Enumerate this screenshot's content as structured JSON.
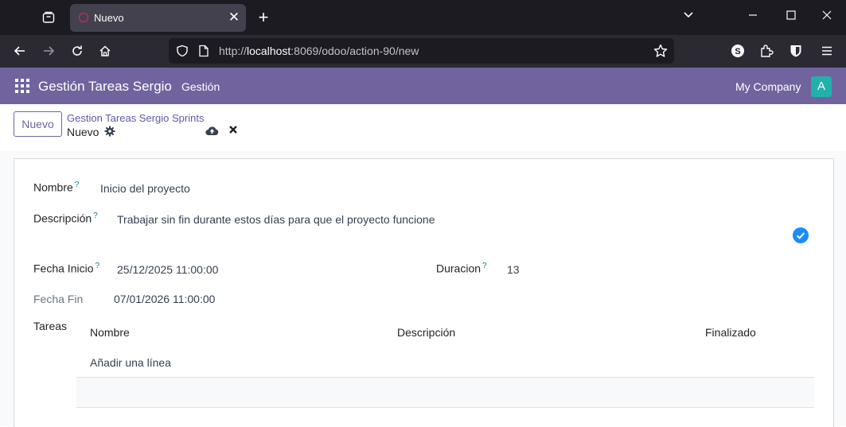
{
  "browser": {
    "tab_title": "Nuevo",
    "url_prefix": "http://",
    "url_host": "localhost",
    "url_rest": ":8069/odoo/action-90/new"
  },
  "app": {
    "name": "Gestión Tareas Sergio",
    "menu": "Gestión",
    "company": "My Company",
    "avatar_letter": "A",
    "accent": "#71639e"
  },
  "control": {
    "new_button": "Nuevo",
    "breadcrumb": "Gestion Tareas Sergio Sprints",
    "record": "Nuevo"
  },
  "form": {
    "nombre_label": "Nombre",
    "nombre_value": "Inicio del proyecto",
    "descripcion_label": "Descripción",
    "descripcion_value": "Trabajar sin fin durante estos días para que el proyecto funcione",
    "fecha_inicio_label": "Fecha Inicio",
    "fecha_inicio_value": "25/12/2025 11:00:00",
    "duracion_label": "Duracion",
    "duracion_value": "13",
    "fecha_fin_label": "Fecha Fin",
    "fecha_fin_value": "07/01/2026 11:00:00",
    "help_mark": "?"
  },
  "tareas": {
    "label": "Tareas",
    "columns": [
      "Nombre",
      "Descripción",
      "Finalizado"
    ],
    "add_line": "Añadir una línea"
  }
}
